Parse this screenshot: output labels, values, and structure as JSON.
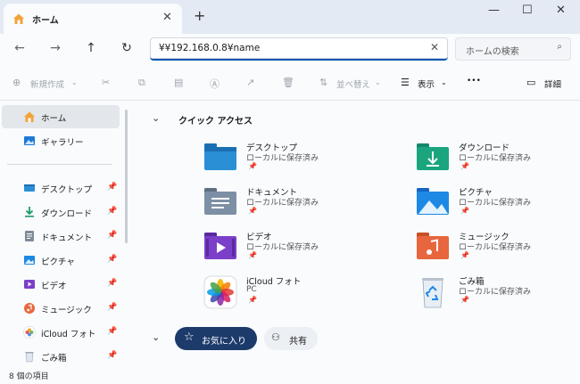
{
  "tab": {
    "title": "ホーム",
    "close": "✕",
    "new": "+"
  },
  "window": {
    "minimize": "—",
    "maximize": "☐",
    "close": "✕"
  },
  "nav": {
    "back": "←",
    "forward": "→",
    "up": "↑",
    "refresh": "↻"
  },
  "address": {
    "value": "¥¥192.168.0.8¥name",
    "clear": "✕"
  },
  "search": {
    "placeholder": "ホームの検索",
    "icon": "⌕"
  },
  "toolbar": {
    "new_label": "新規作成",
    "sort_label": "並べ替え",
    "view_label": "表示",
    "more": "•••",
    "details_label": "詳細"
  },
  "sidebar": {
    "items": [
      {
        "label": "ホーム",
        "icon": "home-icon"
      },
      {
        "label": "ギャラリー",
        "icon": "gallery-icon"
      },
      {
        "label": "デスクトップ",
        "icon": "desktop-icon"
      },
      {
        "label": "ダウンロード",
        "icon": "download-icon"
      },
      {
        "label": "ドキュメント",
        "icon": "documents-icon"
      },
      {
        "label": "ピクチャ",
        "icon": "pictures-icon"
      },
      {
        "label": "ビデオ",
        "icon": "videos-icon"
      },
      {
        "label": "ミュージック",
        "icon": "music-icon"
      },
      {
        "label": "iCloud フォト",
        "icon": "icloud-photos-icon"
      },
      {
        "label": "ごみ箱",
        "icon": "recycle-bin-icon"
      }
    ],
    "pin": "📌"
  },
  "main": {
    "quick_access_title": "クイック アクセス",
    "items": [
      {
        "name": "デスクトップ",
        "sub": "ローカルに保存済み",
        "icon": "desktop-folder-icon"
      },
      {
        "name": "ダウンロード",
        "sub": "ローカルに保存済み",
        "icon": "download-folder-icon"
      },
      {
        "name": "ドキュメント",
        "sub": "ローカルに保存済み",
        "icon": "documents-folder-icon"
      },
      {
        "name": "ピクチャ",
        "sub": "ローカルに保存済み",
        "icon": "pictures-folder-icon"
      },
      {
        "name": "ビデオ",
        "sub": "ローカルに保存済み",
        "icon": "videos-folder-icon"
      },
      {
        "name": "ミュージック",
        "sub": "ローカルに保存済み",
        "icon": "music-folder-icon"
      },
      {
        "name": "iCloud フォト",
        "sub": "PC",
        "icon": "icloud-photos-icon"
      },
      {
        "name": "ごみ箱",
        "sub": "ローカルに保存済み",
        "icon": "recycle-bin-icon"
      }
    ],
    "favorites_label": "お気に入り",
    "shared_label": "共有"
  },
  "status": {
    "text": "8 個の項目"
  },
  "colors": {
    "accent": "#0b57b0",
    "fav_tab": "#1c3b6b"
  }
}
